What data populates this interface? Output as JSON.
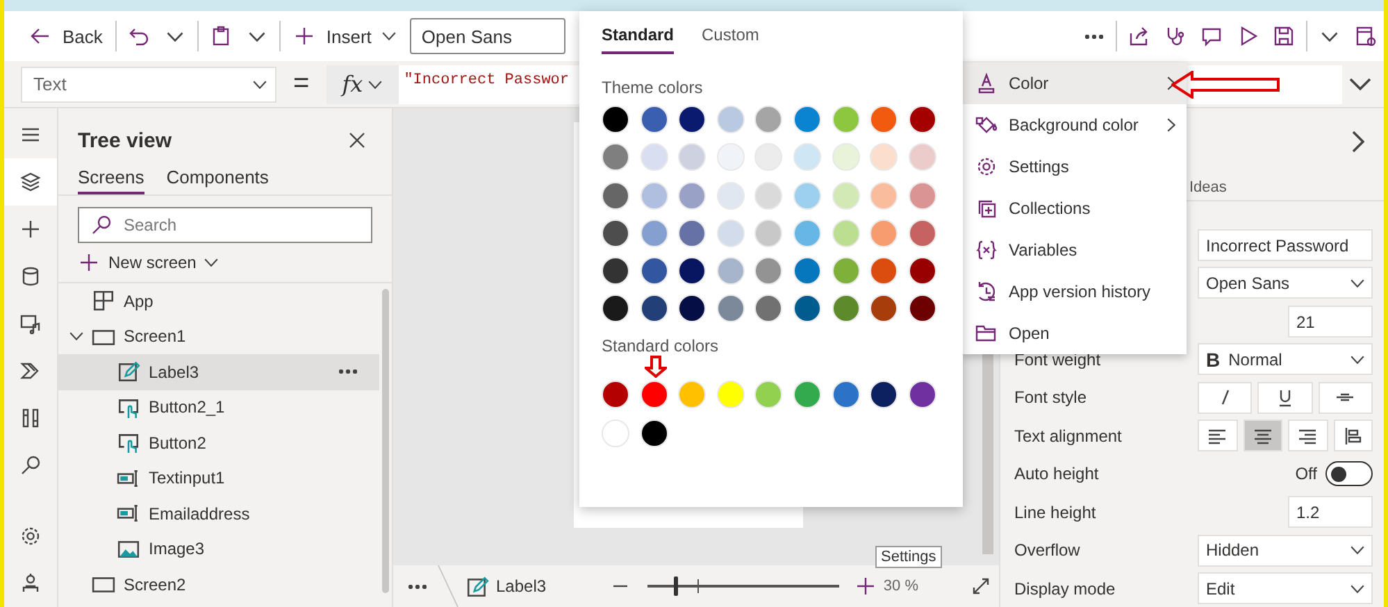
{
  "toolbar": {
    "back": "Back",
    "insert": "Insert",
    "font": "Open Sans"
  },
  "formula_bar": {
    "property": "Text",
    "equals": "=",
    "fx": "fx",
    "formula": "\"Incorrect Passwor"
  },
  "rail": {
    "top_items": [
      {
        "kind": "menu",
        "selected": false
      },
      {
        "kind": "layers",
        "selected": true
      },
      {
        "kind": "plus",
        "selected": false
      },
      {
        "kind": "data",
        "selected": false
      },
      {
        "kind": "media",
        "selected": false
      },
      {
        "kind": "automate",
        "selected": false
      },
      {
        "kind": "tools",
        "selected": false
      },
      {
        "kind": "search",
        "selected": false
      }
    ],
    "bottom_items": [
      {
        "kind": "settings",
        "selected": false
      },
      {
        "kind": "bot",
        "selected": false
      }
    ]
  },
  "tree": {
    "title": "Tree view",
    "tabs": [
      {
        "label": "Screens",
        "selected": true
      },
      {
        "label": "Components",
        "selected": false
      }
    ],
    "search": {
      "placeholder": "Search"
    },
    "new_screen": "New screen",
    "items": [
      {
        "kind": "app",
        "label": "App",
        "selected": false
      },
      {
        "kind": "screen",
        "label": "Screen1",
        "selected": false,
        "expanded": true,
        "children": [
          {
            "kind": "label",
            "label": "Label3",
            "selected": true
          },
          {
            "kind": "button",
            "label": "Button2_1",
            "selected": false
          },
          {
            "kind": "button",
            "label": "Button2",
            "selected": false
          },
          {
            "kind": "input",
            "label": "Textinput1",
            "selected": false
          },
          {
            "kind": "input",
            "label": "Emailaddress",
            "selected": false
          },
          {
            "kind": "image",
            "label": "Image3",
            "selected": false
          }
        ]
      },
      {
        "kind": "screen",
        "label": "Screen2",
        "selected": false
      }
    ]
  },
  "canvas": {
    "breadcrumb": "Label3",
    "zoom": {
      "level": 0.14
    },
    "zoom_text": "30 %",
    "tooltip": "Settings"
  },
  "properties": {
    "tabs": [
      {
        "label": "Ideas",
        "selected": false
      }
    ],
    "rows": [
      {
        "kind": "input",
        "value": "Incorrect Password"
      },
      {
        "kind": "dropdown",
        "value": "Open Sans"
      },
      {
        "kind": "number",
        "value": "21"
      },
      {
        "kind": "dropdown",
        "label": "Font weight",
        "glyph": "B",
        "value": "Normal"
      },
      {
        "kind": "buttons",
        "label": "Font style",
        "buttons": [
          {
            "kind": "italic",
            "selected": false
          },
          {
            "kind": "underline",
            "selected": false
          },
          {
            "kind": "strikethrough",
            "selected": false
          }
        ]
      },
      {
        "kind": "buttons",
        "label": "Text alignment",
        "buttons": [
          {
            "kind": "align-left",
            "selected": false
          },
          {
            "kind": "align-center",
            "selected": true
          },
          {
            "kind": "align-right",
            "selected": false
          },
          {
            "kind": "align-top",
            "selected": false
          }
        ]
      },
      {
        "kind": "toggle",
        "label": "Auto height",
        "state_text": "Off",
        "on": false
      },
      {
        "kind": "number",
        "label": "Line height",
        "value": "1.2"
      },
      {
        "kind": "dropdown",
        "label": "Overflow",
        "value": "Hidden"
      },
      {
        "kind": "dropdown",
        "label": "Display mode",
        "value": "Edit"
      }
    ]
  },
  "context_menu": {
    "items": [
      {
        "kind": "color",
        "label": "Color",
        "submenu": true,
        "selected": true
      },
      {
        "kind": "background",
        "label": "Background color",
        "submenu": true,
        "selected": false
      },
      {
        "kind": "settings",
        "label": "Settings",
        "submenu": false,
        "selected": false
      },
      {
        "kind": "collections",
        "label": "Collections",
        "submenu": false,
        "selected": false
      },
      {
        "kind": "variables",
        "label": "Variables",
        "submenu": false,
        "selected": false
      },
      {
        "kind": "history",
        "label": "App version history",
        "submenu": false,
        "selected": false
      },
      {
        "kind": "folder",
        "label": "Open",
        "submenu": false,
        "selected": false
      }
    ]
  },
  "color_picker": {
    "tabs": [
      {
        "label": "Standard",
        "selected": true
      },
      {
        "label": "Custom",
        "selected": false
      }
    ],
    "theme_heading": "Theme colors",
    "theme_colors": [
      {
        "color": "#000000"
      },
      {
        "color": "#3a5fb0"
      },
      {
        "color": "#0a1a6e"
      },
      {
        "color": "#b8c9e1"
      },
      {
        "color": "#a5a5a5"
      },
      {
        "color": "#0a84d0"
      },
      {
        "color": "#8dc63f"
      },
      {
        "color": "#f15a0f"
      },
      {
        "color": "#a50000"
      },
      {
        "color": "#7f7f7f"
      },
      {
        "color": "#d9def0"
      },
      {
        "color": "#ced1e0"
      },
      {
        "color": "#f0f3f8"
      },
      {
        "color": "#ececec"
      },
      {
        "color": "#cfe6f5"
      },
      {
        "color": "#e8f3da"
      },
      {
        "color": "#fcdecf"
      },
      {
        "color": "#eccbcb"
      },
      {
        "color": "#666666"
      },
      {
        "color": "#b0bfe0"
      },
      {
        "color": "#9aa1c6"
      },
      {
        "color": "#e1e7f1"
      },
      {
        "color": "#dadada"
      },
      {
        "color": "#9dd0ef"
      },
      {
        "color": "#d2e9b6"
      },
      {
        "color": "#f9bd9e"
      },
      {
        "color": "#da9494"
      },
      {
        "color": "#4d4d4d"
      },
      {
        "color": "#859fd0"
      },
      {
        "color": "#6672a6"
      },
      {
        "color": "#d3dcea"
      },
      {
        "color": "#c8c8c8"
      },
      {
        "color": "#66b7e5"
      },
      {
        "color": "#bcde90"
      },
      {
        "color": "#f79c6e"
      },
      {
        "color": "#c76262"
      },
      {
        "color": "#333333"
      },
      {
        "color": "#3356a0"
      },
      {
        "color": "#081560"
      },
      {
        "color": "#a6b5cc"
      },
      {
        "color": "#939393"
      },
      {
        "color": "#0677bd"
      },
      {
        "color": "#7fb13a"
      },
      {
        "color": "#db4d0e"
      },
      {
        "color": "#980000"
      },
      {
        "color": "#1a1a1a"
      },
      {
        "color": "#233f77"
      },
      {
        "color": "#050f45"
      },
      {
        "color": "#7c899b"
      },
      {
        "color": "#717171"
      },
      {
        "color": "#005b8f"
      },
      {
        "color": "#5d8a2b"
      },
      {
        "color": "#a83d0c"
      },
      {
        "color": "#6d0000"
      }
    ],
    "standard_heading": "Standard colors",
    "standard_colors": [
      {
        "color": "#b30000"
      },
      {
        "color": "#ff0000"
      },
      {
        "color": "#ffc000"
      },
      {
        "color": "#ffff00"
      },
      {
        "color": "#92d050"
      },
      {
        "color": "#33aa4d"
      },
      {
        "color": "#2c72c7"
      },
      {
        "color": "#0d2060"
      },
      {
        "color": "#7030a0"
      },
      {
        "color": "#ffffff"
      },
      {
        "color": "#000000"
      }
    ]
  }
}
